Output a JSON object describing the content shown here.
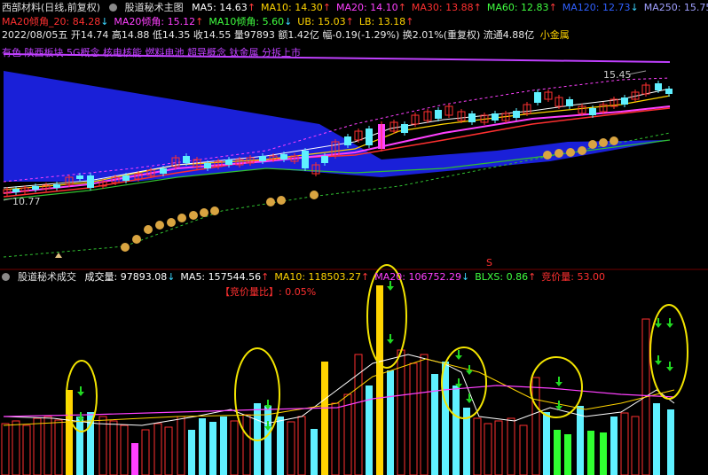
{
  "header": {
    "stock_title": "西部材料(日线,前复权)",
    "main_indicator": "股道秘术主图",
    "ma": [
      {
        "label": "MA5: 14.63",
        "color": "#ffffff",
        "dir": "↑"
      },
      {
        "label": "MA10: 14.30",
        "color": "#ffd400",
        "dir": "↑"
      },
      {
        "label": "MA20: 14.10",
        "color": "#ff40ff",
        "dir": "↑"
      },
      {
        "label": "MA30: 13.88",
        "color": "#ff3030",
        "dir": "↑"
      },
      {
        "label": "MA60: 12.83",
        "color": "#40ff40",
        "dir": "↑"
      },
      {
        "label": "MA120: 12.73",
        "color": "#3060ff",
        "dir": "↓"
      },
      {
        "label": "MA250: 15.75",
        "color": "#a0a0ff",
        "dir": "↓"
      }
    ],
    "line2": [
      {
        "label": "MA20倾角_20: 84.28",
        "color": "#ff3030",
        "dir": "↓"
      },
      {
        "label": "MA20倾角: 15.12",
        "color": "#ff40ff",
        "dir": "↑"
      },
      {
        "label": "MA10倾角: 5.60",
        "color": "#40ff40",
        "dir": "↓"
      },
      {
        "label": "UB: 15.03",
        "color": "#ffd400",
        "dir": "↑"
      },
      {
        "label": "LB: 13.18",
        "color": "#ffd400",
        "dir": "↑"
      }
    ],
    "quote": "2022/08/05五 开14.74 高14.88 低14.35 收14.55 量97893 额1.42亿 幅-0.19(-1.29%) 换2.01%(重复权) 流通4.88亿",
    "quote_tag": "小金属",
    "concepts": "有色 陕西板块 5G概念 核电核能 燃料电池 超导概念 钛金属 分拆上市",
    "price_high_label": "15.45",
    "price_low_label": "10.77",
    "sell_marker": "S"
  },
  "volume": {
    "indicator": "股道秘术成交",
    "items": [
      {
        "label": "成交量: 97893.08",
        "color": "#ffffff",
        "dir": "↓"
      },
      {
        "label": "MA5: 157544.56",
        "color": "#ffffff",
        "dir": "↑"
      },
      {
        "label": "MA10: 118503.27",
        "color": "#ffd400",
        "dir": "↑"
      },
      {
        "label": "MA20: 106752.29",
        "color": "#ff40ff",
        "dir": "↓"
      },
      {
        "label": "BLXS: 0.86",
        "color": "#40ff40",
        "dir": "↑"
      },
      {
        "label": "竞价量: 53.00",
        "color": "#ff3030",
        "dir": ""
      }
    ],
    "bid_ratio": "【竞价量比】: 0.05%"
  },
  "colors": {
    "up": "#ff3030",
    "down": "#5ff0ff",
    "band": "#1a20d8",
    "bag": "#d9a441",
    "circle": "#f2e400",
    "arrow": "#22d822"
  }
}
